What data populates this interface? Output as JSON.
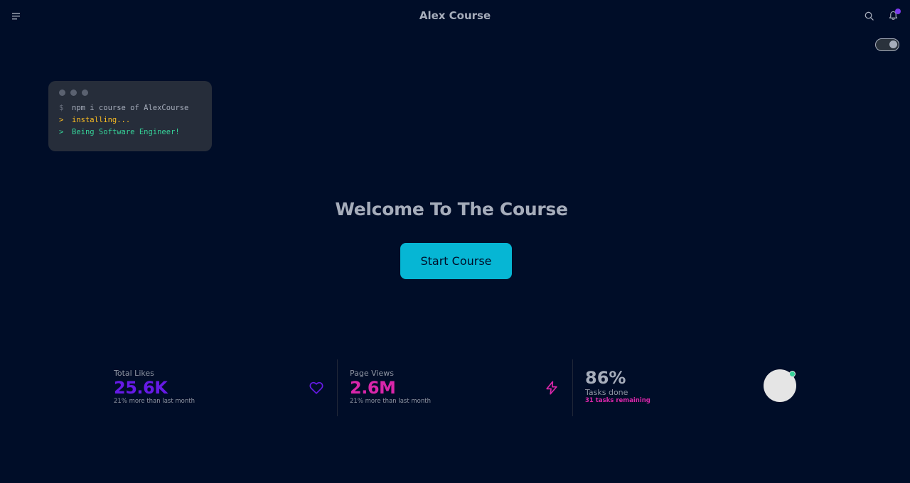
{
  "navbar": {
    "brand": "Alex Course",
    "menu_icon": "hamburger-icon",
    "search_icon": "search-icon",
    "bell_icon": "bell-icon",
    "notification_dot_color": "#7c3aed"
  },
  "theme_toggle": {
    "state": "on"
  },
  "terminal": {
    "lines": [
      {
        "prefix": "$",
        "text": "npm i course of AlexCourse",
        "color": "#a6adbb"
      },
      {
        "prefix": ">",
        "text": "installing...",
        "color": "#fbbd23"
      },
      {
        "prefix": ">",
        "text": "Being Software Engineer!",
        "color": "#36d399"
      }
    ]
  },
  "hero": {
    "title": "Welcome To The Course",
    "cta_label": "Start Course",
    "cta_color": "#06b6d4"
  },
  "stats": {
    "likes": {
      "title": "Total Likes",
      "value": "25.6K",
      "desc": "21% more than last month",
      "color": "#661ae6",
      "icon": "heart-icon"
    },
    "views": {
      "title": "Page Views",
      "value": "2.6M",
      "desc": "21% more than last month",
      "color": "#d926aa",
      "icon": "lightning-icon"
    },
    "tasks": {
      "value": "86%",
      "title": "Tasks done",
      "desc": "31 tasks remaining",
      "desc_color": "#d926aa",
      "online_color": "#36d399"
    }
  }
}
